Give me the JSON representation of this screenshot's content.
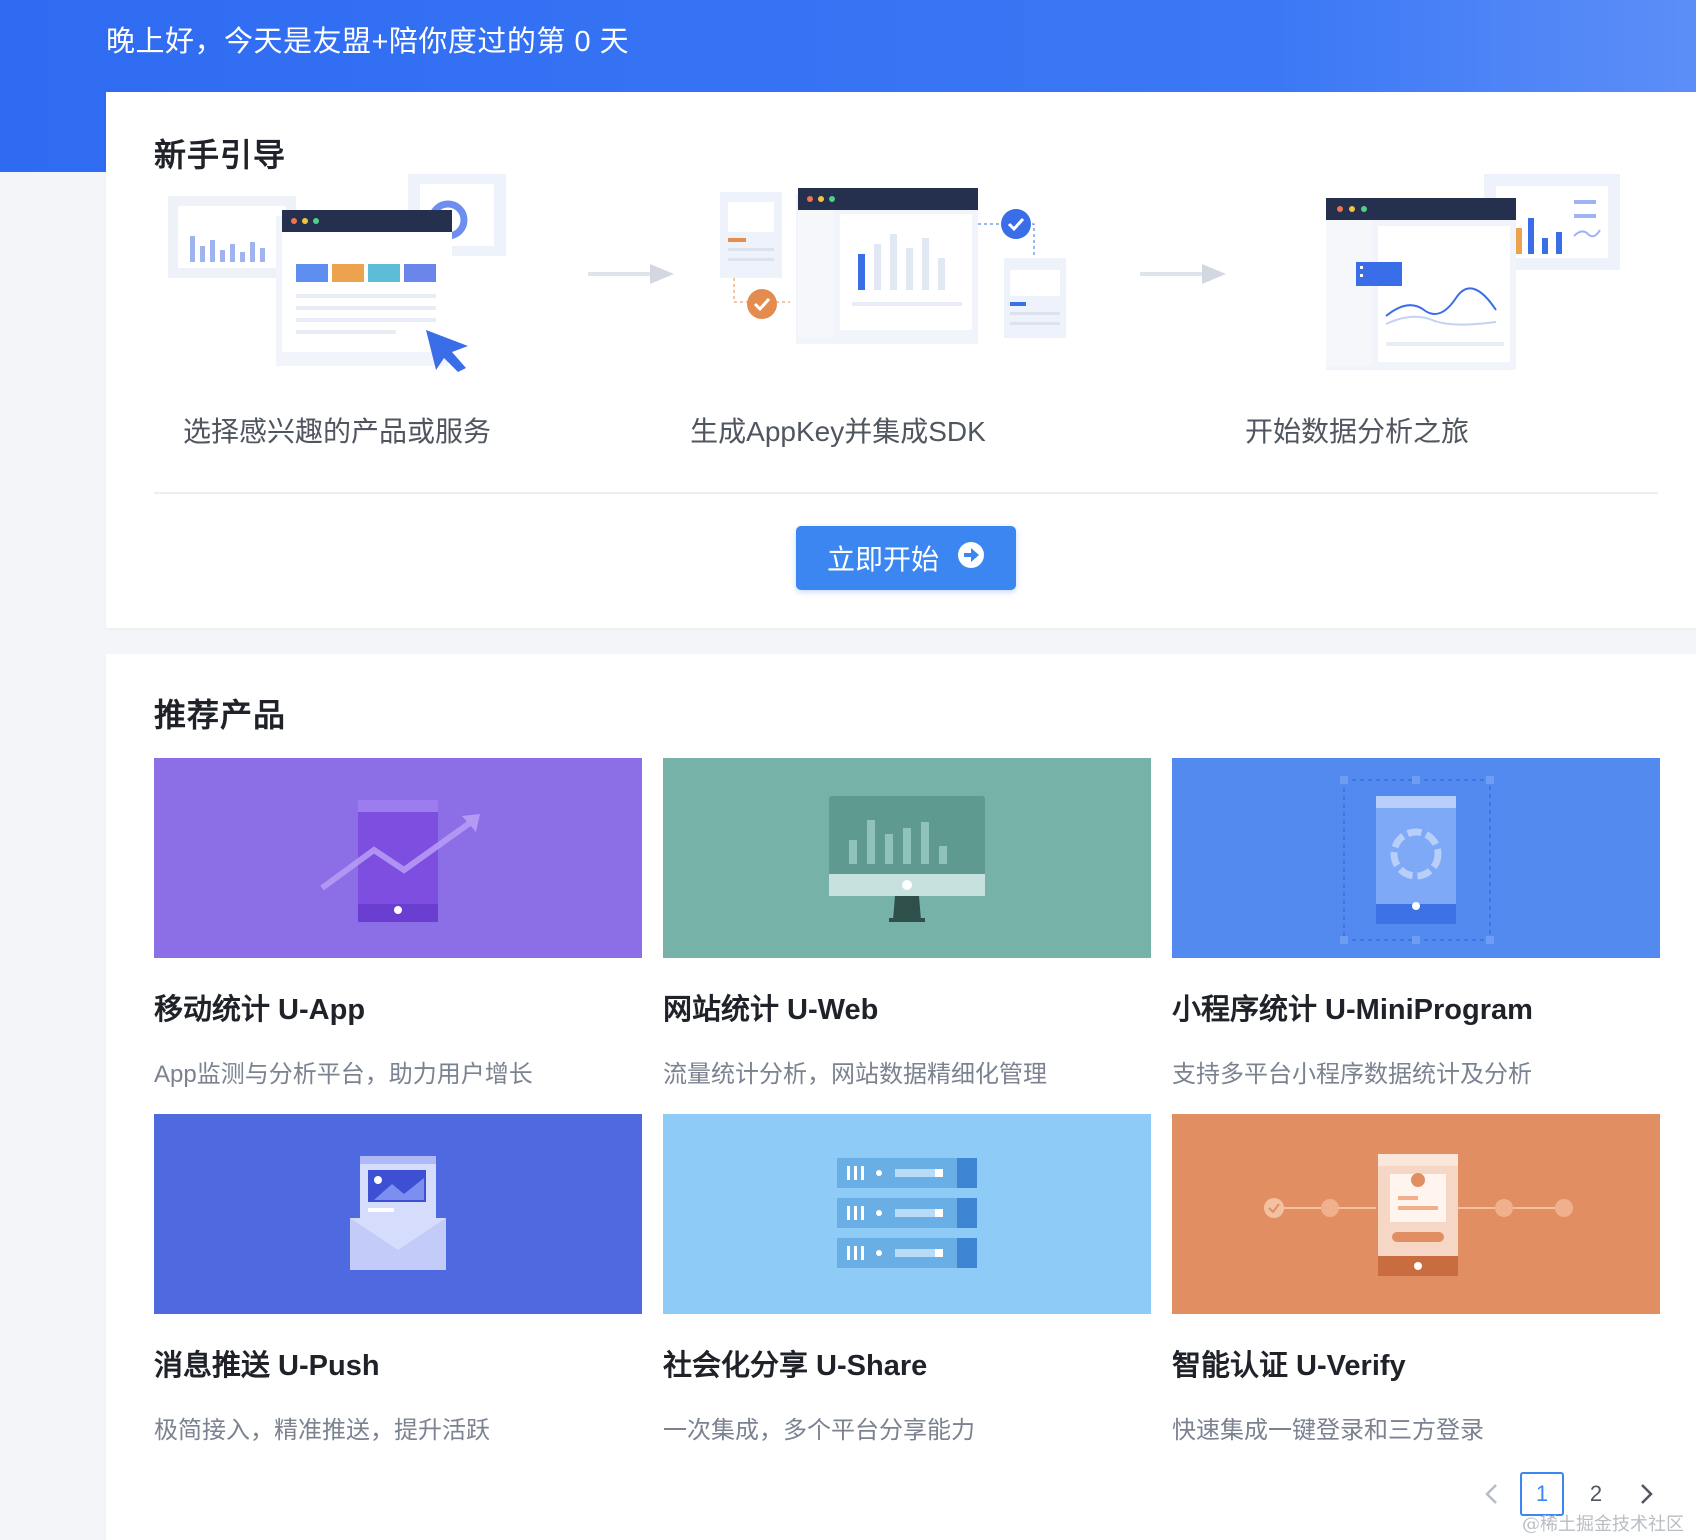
{
  "header": {
    "greeting": "晚上好，今天是友盟+陪你度过的第 0 天"
  },
  "guide": {
    "title": "新手引导",
    "steps": [
      {
        "label": "选择感兴趣的产品或服务"
      },
      {
        "label": "生成AppKey并集成SDK"
      },
      {
        "label": "开始数据分析之旅"
      }
    ],
    "start_button": "立即开始"
  },
  "products": {
    "title": "推荐产品",
    "items": [
      {
        "name": "移动统计 U-App",
        "desc": "App监测与分析平台，助力用户增长",
        "color": "#8c6ee6"
      },
      {
        "name": "网站统计 U-Web",
        "desc": "流量统计分析，网站数据精细化管理",
        "color": "#77b2a8"
      },
      {
        "name": "小程序统计 U-MiniProgram",
        "desc": "支持多平台小程序数据统计及分析",
        "color": "#528af0"
      },
      {
        "name": "消息推送 U-Push",
        "desc": "极简接入，精准推送，提升活跃",
        "color": "#4f6ae0"
      },
      {
        "name": "社会化分享 U-Share",
        "desc": "一次集成，多个平台分享能力",
        "color": "#8ecbf7"
      },
      {
        "name": "智能认证 U-Verify",
        "desc": "快速集成一键登录和三方登录",
        "color": "#e28e63"
      }
    ]
  },
  "pagination": {
    "pages": [
      "1",
      "2"
    ],
    "current": "1"
  },
  "watermark": "@稀土掘金技术社区"
}
